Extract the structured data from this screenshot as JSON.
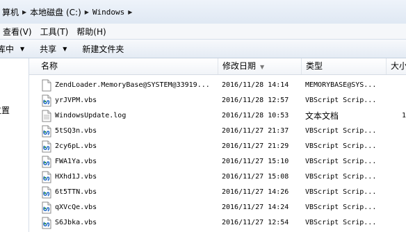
{
  "address": {
    "crumbs": [
      "算机",
      "本地磁盘 (C:)",
      "Windows"
    ]
  },
  "menu": {
    "items": [
      "查看(V)",
      "工具(T)",
      "帮助(H)"
    ]
  },
  "commands": {
    "include": "库中",
    "share": "共享",
    "new_folder": "新建文件夹"
  },
  "nav": {
    "partial_label": "位置"
  },
  "columns": {
    "name": "名称",
    "date": "修改日期",
    "type": "类型",
    "size": "大小"
  },
  "files": [
    {
      "name": "ZendLoader.MemoryBase@SYSTEM@33919...",
      "date": "2016/11/28 14:14",
      "type": "MEMORYBASE@SYS...",
      "size": "",
      "icon": "generic-file-icon"
    },
    {
      "name": "yrJVPM.vbs",
      "date": "2016/11/28 12:57",
      "type": "VBScript Scrip...",
      "size": "",
      "icon": "vbscript-file-icon"
    },
    {
      "name": "WindowsUpdate.log",
      "date": "2016/11/28 10:53",
      "type": "文本文档",
      "size": "1",
      "icon": "text-file-icon"
    },
    {
      "name": "5tSQ3n.vbs",
      "date": "2016/11/27 21:37",
      "type": "VBScript Scrip...",
      "size": "",
      "icon": "vbscript-file-icon"
    },
    {
      "name": "2cy6pL.vbs",
      "date": "2016/11/27 21:29",
      "type": "VBScript Scrip...",
      "size": "",
      "icon": "vbscript-file-icon"
    },
    {
      "name": "FWA1Ya.vbs",
      "date": "2016/11/27 15:10",
      "type": "VBScript Scrip...",
      "size": "",
      "icon": "vbscript-file-icon"
    },
    {
      "name": "HXhd1J.vbs",
      "date": "2016/11/27 15:08",
      "type": "VBScript Scrip...",
      "size": "",
      "icon": "vbscript-file-icon"
    },
    {
      "name": "6t5TTN.vbs",
      "date": "2016/11/27 14:26",
      "type": "VBScript Scrip...",
      "size": "",
      "icon": "vbscript-file-icon"
    },
    {
      "name": "qXVcQe.vbs",
      "date": "2016/11/27 14:24",
      "type": "VBScript Scrip...",
      "size": "",
      "icon": "vbscript-file-icon"
    },
    {
      "name": "S6Jbka.vbs",
      "date": "2016/11/27 12:54",
      "type": "VBScript Scrip...",
      "size": "",
      "icon": "vbscript-file-icon"
    }
  ]
}
